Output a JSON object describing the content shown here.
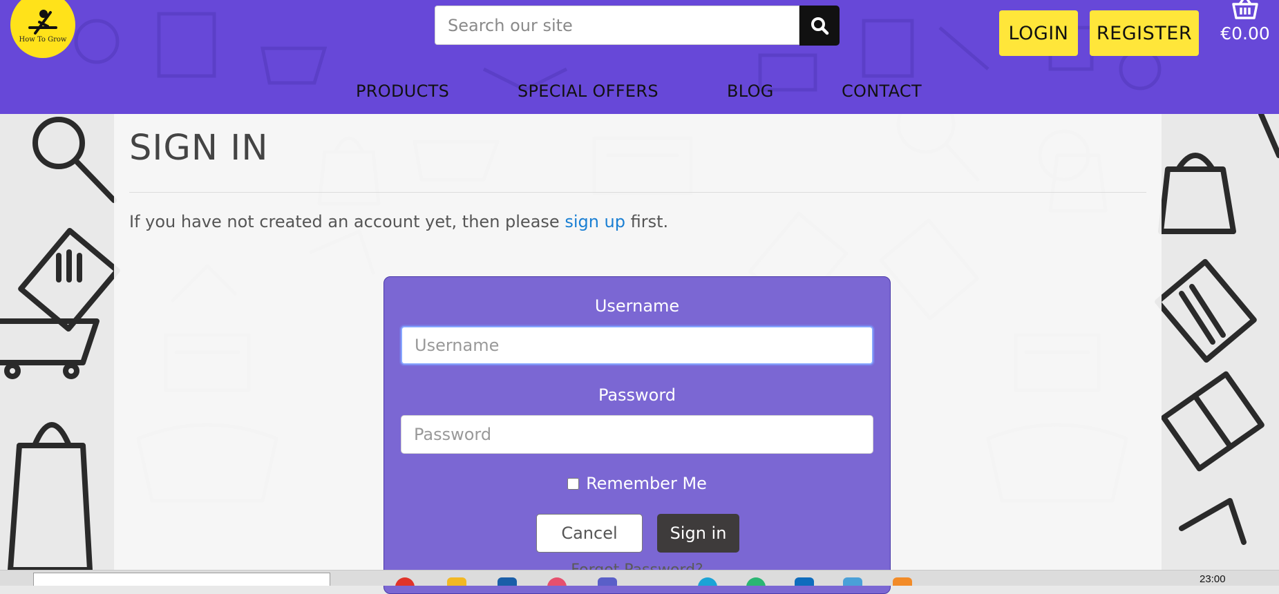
{
  "header": {
    "logo_text": "How To Grow",
    "search_placeholder": "Search our site",
    "login_label": "LOGIN",
    "register_label": "REGISTER",
    "cart_total": "€0.00",
    "nav": [
      "PRODUCTS",
      "SPECIAL OFFERS",
      "BLOG",
      "CONTACT"
    ]
  },
  "main": {
    "title": "SIGN IN",
    "intro_before": "If you have not created an account yet, then please ",
    "intro_link": "sign up",
    "intro_after": " first.",
    "form": {
      "username_label": "Username",
      "username_placeholder": "Username",
      "username_value": "",
      "password_label": "Password",
      "password_placeholder": "Password",
      "password_value": "",
      "remember_label": "Remember Me",
      "remember_checked": false,
      "cancel_label": "Cancel",
      "signin_label": "Sign in",
      "forgot_label": "Forgot Password?"
    }
  },
  "taskbar": {
    "clock": "23:00"
  },
  "colors": {
    "header_bg": "#6748d8",
    "accent_yellow": "#ffe63a",
    "card_bg": "#7b67d3",
    "link": "#1a7fd3"
  }
}
